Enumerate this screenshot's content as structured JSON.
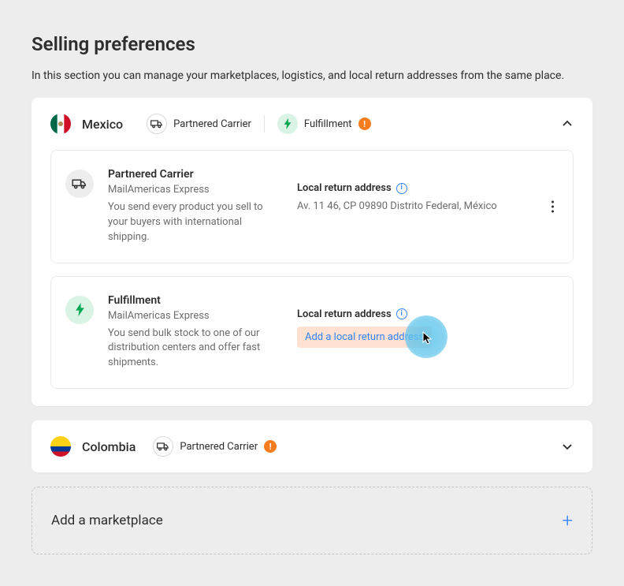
{
  "page": {
    "title": "Selling preferences",
    "subtitle": "In this section you can manage your marketplaces, logistics, and local return addresses from the same place."
  },
  "labels": {
    "partnered_carrier": "Partnered Carrier",
    "fulfillment": "Fulfillment",
    "local_return_address": "Local return address",
    "add_local_return": "Add a local return address",
    "add_marketplace": "Add a marketplace"
  },
  "countries": {
    "mexico": {
      "name": "Mexico",
      "expanded": true,
      "methods": {
        "partnered": {
          "title": "Partnered Carrier",
          "provider": "MailAmericas Express",
          "desc": "You send every product you sell to your buyers with international shipping.",
          "return_address": "Av. 11 46, CP 09890 Distrito Federal, México"
        },
        "fulfillment": {
          "title": "Fulfillment",
          "provider": "MailAmericas Express",
          "desc": "You send bulk stock to one of our distribution centers and offer fast shipments."
        }
      }
    },
    "colombia": {
      "name": "Colombia",
      "expanded": false,
      "has_alert": true
    }
  }
}
